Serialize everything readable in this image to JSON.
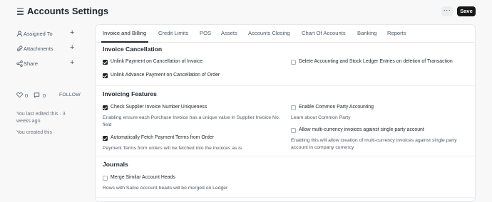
{
  "header": {
    "title": "Accounts Settings",
    "more_label": "···",
    "save_label": "Save"
  },
  "sidebar": {
    "items": [
      {
        "label": "Assigned To",
        "icon": "user-icon"
      },
      {
        "label": "Attachments",
        "icon": "paperclip-icon"
      },
      {
        "label": "Share",
        "icon": "share-icon"
      }
    ],
    "plus": "+",
    "likes": "0",
    "comments": "0",
    "follow_label": "FOLLOW",
    "edited_text": "You last edited this · 3 weeks ago",
    "created_text": "You created this ·"
  },
  "tabs": [
    "Invoice and Billing",
    "Credit Limits",
    "POS",
    "Assets",
    "Accounts Closing",
    "Chart Of Accounts",
    "Banking",
    "Reports"
  ],
  "sections": {
    "invoice_cancellation": {
      "title": "Invoice Cancellation",
      "unlink_payment": {
        "label": "Unlink Payment on Cancellation of Invoice",
        "checked": true
      },
      "unlink_advance": {
        "label": "Unlink Advance Payment on Cancellation of Order",
        "checked": true
      },
      "delete_entries": {
        "label": "Delete Accounting and Stock Ledger Entries on deletion of Transaction",
        "checked": false
      }
    },
    "invoicing_features": {
      "title": "Invoicing Features",
      "check_supplier": {
        "label": "Check Supplier Invoice Number Uniqueness",
        "checked": true,
        "desc": "Enabling ensure each Purchase Invoice has a unique value in Supplier Invoice No. field"
      },
      "auto_fetch": {
        "label": "Automatically Fetch Payment Terms from Order",
        "checked": true,
        "desc": "Payment Terms from orders will be fetched into the invoices as is"
      },
      "common_party": {
        "label": "Enable Common Party Accounting",
        "checked": false,
        "desc": "Learn about Common Party"
      },
      "multi_currency": {
        "label": "Allow multi-currency invoices against single party account",
        "checked": false,
        "desc": "Enabling this will allow creation of multi-currency invoices against single party account in company currency"
      }
    },
    "journals": {
      "title": "Journals",
      "merge_heads": {
        "label": "Merge Similar Account Heads",
        "checked": false,
        "desc": "Rows with Same Account heads will be merged on Ledger"
      }
    }
  },
  "colors": {
    "primary": "#171717",
    "text": "#1f272e",
    "muted": "#4c5a67",
    "border": "#e5e8eb"
  }
}
